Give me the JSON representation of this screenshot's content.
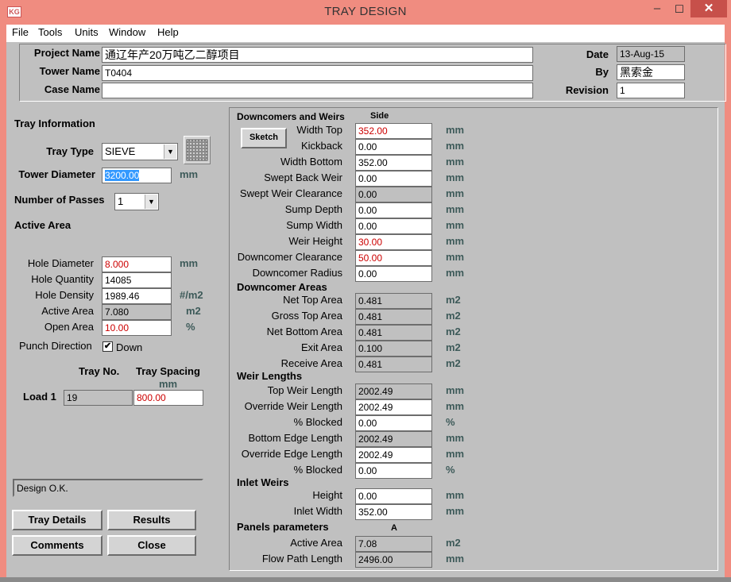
{
  "window": {
    "title": "TRAY DESIGN",
    "icon_text": "KG"
  },
  "menu": [
    "File",
    "Tools",
    "Units",
    "Window",
    "Help"
  ],
  "header": {
    "project_label": "Project Name",
    "project_value": "通辽年产20万吨乙二醇项目",
    "tower_label": "Tower Name",
    "tower_value": "T0404",
    "case_label": "Case Name",
    "case_value": "",
    "date_label": "Date",
    "date_value": "13-Aug-15",
    "by_label": "By",
    "by_value": "黑索金",
    "revision_label": "Revision",
    "revision_value": "1"
  },
  "tray_info": {
    "section_title": "Tray Information",
    "tray_type_label": "Tray Type",
    "tray_type_value": "SIEVE",
    "tower_diameter_label": "Tower Diameter",
    "tower_diameter_value": "3200.00",
    "tower_diameter_unit": "mm",
    "passes_label": "Number of Passes",
    "passes_value": "1"
  },
  "active_area": {
    "section_title": "Active Area",
    "hole_diameter_label": "Hole Diameter",
    "hole_diameter_value": "8.000",
    "hole_diameter_unit": "mm",
    "hole_quantity_label": "Hole Quantity",
    "hole_quantity_value": "14085",
    "hole_density_label": "Hole Density",
    "hole_density_value": "1989.46",
    "hole_density_unit": "#/m2",
    "active_area_label": "Active Area",
    "active_area_value": "7.080",
    "active_area_unit": "m2",
    "open_area_label": "Open Area",
    "open_area_value": "10.00",
    "open_area_unit": "%",
    "punch_label": "Punch Direction",
    "punch_checked": "✔",
    "punch_value": "Down"
  },
  "loads": {
    "tray_no_header": "Tray No.",
    "spacing_header": "Tray Spacing",
    "spacing_unit": "mm",
    "load_label": "Load 1",
    "tray_no_value": "19",
    "spacing_value": "800.00"
  },
  "status": "Design O.K.",
  "buttons": {
    "tray_details": "Tray Details",
    "results": "Results",
    "comments": "Comments",
    "close": "Close",
    "sketch": "Sketch"
  },
  "downcomers": {
    "section_title": "Downcomers and Weirs",
    "column_header": "Side",
    "rows": [
      {
        "label": "Width Top",
        "value": "352.00",
        "unit": "mm"
      },
      {
        "label": "Kickback",
        "value": "0.00",
        "unit": "mm"
      },
      {
        "label": "Width Bottom",
        "value": "352.00",
        "unit": "mm"
      },
      {
        "label": "Swept Back Weir",
        "value": "0.00",
        "unit": "mm"
      },
      {
        "label": "Swept Weir Clearance",
        "value": "0.00",
        "unit": "mm"
      },
      {
        "label": "Sump Depth",
        "value": "0.00",
        "unit": "mm"
      },
      {
        "label": "Sump Width",
        "value": "0.00",
        "unit": "mm"
      },
      {
        "label": "Weir Height",
        "value": "30.00",
        "unit": "mm"
      },
      {
        "label": "Downcomer Clearance",
        "value": "50.00",
        "unit": "mm"
      },
      {
        "label": "Downcomer Radius",
        "value": "0.00",
        "unit": "mm"
      }
    ]
  },
  "downcomer_areas": {
    "section_title": "Downcomer Areas",
    "rows": [
      {
        "label": "Net Top Area",
        "value": "0.481",
        "unit": "m2"
      },
      {
        "label": "Gross Top Area",
        "value": "0.481",
        "unit": "m2"
      },
      {
        "label": "Net Bottom Area",
        "value": "0.481",
        "unit": "m2"
      },
      {
        "label": "Exit Area",
        "value": "0.100",
        "unit": "m2"
      },
      {
        "label": "Receive Area",
        "value": "0.481",
        "unit": "m2"
      }
    ]
  },
  "weir_lengths": {
    "section_title": "Weir Lengths",
    "rows": [
      {
        "label": "Top Weir Length",
        "value": "2002.49",
        "unit": "mm"
      },
      {
        "label": "Override Weir Length",
        "value": "2002.49",
        "unit": "mm"
      },
      {
        "label": "% Blocked",
        "value": "0.00",
        "unit": "%"
      },
      {
        "label": "Bottom Edge Length",
        "value": "2002.49",
        "unit": "mm"
      },
      {
        "label": "Override Edge Length",
        "value": "2002.49",
        "unit": "mm"
      },
      {
        "label": "% Blocked",
        "value": "0.00",
        "unit": "%"
      }
    ]
  },
  "inlet_weirs": {
    "section_title": "Inlet Weirs",
    "rows": [
      {
        "label": "Height",
        "value": "0.00",
        "unit": "mm"
      },
      {
        "label": "Inlet Width",
        "value": "352.00",
        "unit": "mm"
      }
    ]
  },
  "panels": {
    "section_title": "Panels parameters",
    "column_header": "A",
    "rows": [
      {
        "label": "Active Area",
        "value": "7.08",
        "unit": "m2"
      },
      {
        "label": "Flow Path Length",
        "value": "2496.00",
        "unit": "mm"
      }
    ]
  }
}
